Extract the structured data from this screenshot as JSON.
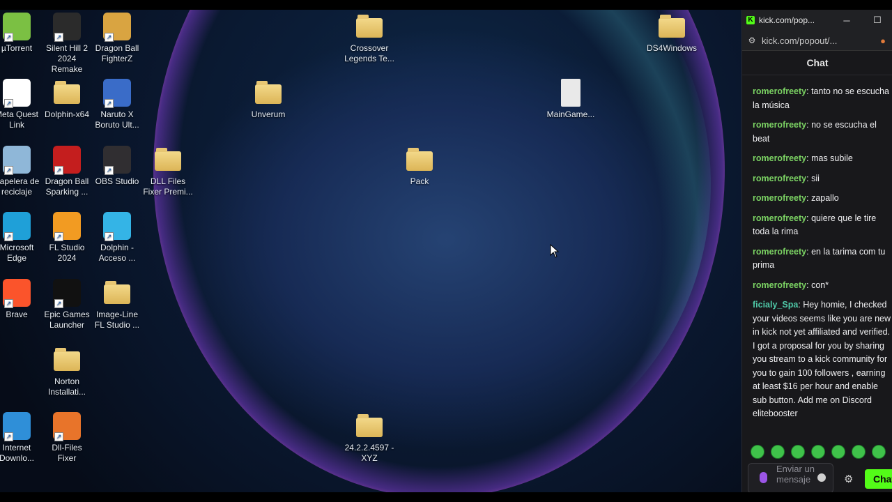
{
  "desktop": {
    "icons": [
      {
        "label": "µTorrent",
        "type": "app",
        "color": "#7bc043"
      },
      {
        "label": "Silent Hill 2 2024 Remake",
        "type": "app",
        "color": "#2b2b2b"
      },
      {
        "label": "Dragon Ball FighterZ",
        "type": "app",
        "color": "#d9a441"
      },
      {
        "label": "Crossover Legends Te...",
        "type": "folder"
      },
      {
        "label": "DS4Windows",
        "type": "folder"
      },
      {
        "label": "Meta Quest Link",
        "type": "app",
        "color": "#ffffff"
      },
      {
        "label": "Dolphin-x64",
        "type": "folder"
      },
      {
        "label": "Naruto X Boruto Ult...",
        "type": "app",
        "color": "#3a6cc8"
      },
      {
        "label": "Unverum",
        "type": "folder"
      },
      {
        "label": "MainGame...",
        "type": "file"
      },
      {
        "label": "Papelera de reciclaje",
        "type": "app",
        "color": "#8fb7d8"
      },
      {
        "label": "Dragon Ball Sparking ...",
        "type": "app",
        "color": "#c41e1e"
      },
      {
        "label": "OBS Studio",
        "type": "app",
        "color": "#302e31"
      },
      {
        "label": "DLL Files Fixer Premi...",
        "type": "folder"
      },
      {
        "label": "Pack",
        "type": "folder"
      },
      {
        "label": "Microsoft Edge",
        "type": "app",
        "color": "#1fa0d8"
      },
      {
        "label": "FL Studio 2024",
        "type": "app",
        "color": "#f29b22"
      },
      {
        "label": "Dolphin - Acceso ...",
        "type": "app",
        "color": "#34b4e6"
      },
      {
        "label": "Brave",
        "type": "app",
        "color": "#fb542b"
      },
      {
        "label": "Epic Games Launcher",
        "type": "app",
        "color": "#111111"
      },
      {
        "label": "Image-Line FL Studio ...",
        "type": "folder"
      },
      {
        "label": "Norton Installati...",
        "type": "folder"
      },
      {
        "label": "Internet Downlo...",
        "type": "app",
        "color": "#2f8fd8"
      },
      {
        "label": "Dll-Files Fixer",
        "type": "app",
        "color": "#e8742a"
      },
      {
        "label": "24.2.2.4597 - XYZ",
        "type": "folder"
      }
    ]
  },
  "browser": {
    "tab_title": "kick.com/pop...",
    "url": "kick.com/popout/...",
    "chat_title": "Chat",
    "messages": [
      {
        "user": "romerofreety",
        "text": "tanto no se escucha la música",
        "color": "#7bd263"
      },
      {
        "user": "romerofreety",
        "text": "no se escucha el beat",
        "color": "#7bd263"
      },
      {
        "user": "romerofreety",
        "text": "mas subile",
        "color": "#7bd263"
      },
      {
        "user": "romerofreety",
        "text": "sii",
        "color": "#7bd263"
      },
      {
        "user": "romerofreety",
        "text": "zapallo",
        "color": "#7bd263"
      },
      {
        "user": "romerofreety",
        "text": "quiere que le tire toda la rima",
        "color": "#7bd263"
      },
      {
        "user": "romerofreety",
        "text": "en la tarima com tu prima",
        "color": "#7bd263"
      },
      {
        "user": "romerofreety",
        "text": "con*",
        "color": "#7bd263"
      },
      {
        "user": "ficialy_Spa",
        "text": "Hey homie, I checked your videos seems like you are new in kick not yet affiliated and verified. I got a proposal for you by sharing you stream to a kick community for you to gain 100 followers , earning at least $16 per hour and enable sub button. Add me on Discord elitebooster",
        "color": "#4fc9a8"
      }
    ],
    "input_placeholder": "Enviar un mensaje",
    "send_label": "Chat",
    "accent": "#53fc18"
  }
}
